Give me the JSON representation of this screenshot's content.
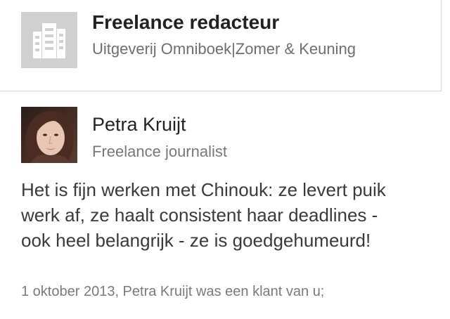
{
  "position": {
    "logo_icon": "building-icon",
    "title": "Freelance redacteur",
    "company": "Uitgeverij Omniboek|Zomer & Keuning"
  },
  "recommendation": {
    "recommender": {
      "name": "Petra Kruijt",
      "headline": "Freelance journalist",
      "avatar": "profile-photo"
    },
    "text_lines": [
      "Het is fijn werken met Chinouk: ze levert puik",
      "werk af, ze haalt consistent haar deadlines -",
      "ook heel belangrijk - ze is goedgehumeurd!"
    ],
    "meta": "1 oktober 2013, Petra Kruijt was een klant van u;"
  }
}
